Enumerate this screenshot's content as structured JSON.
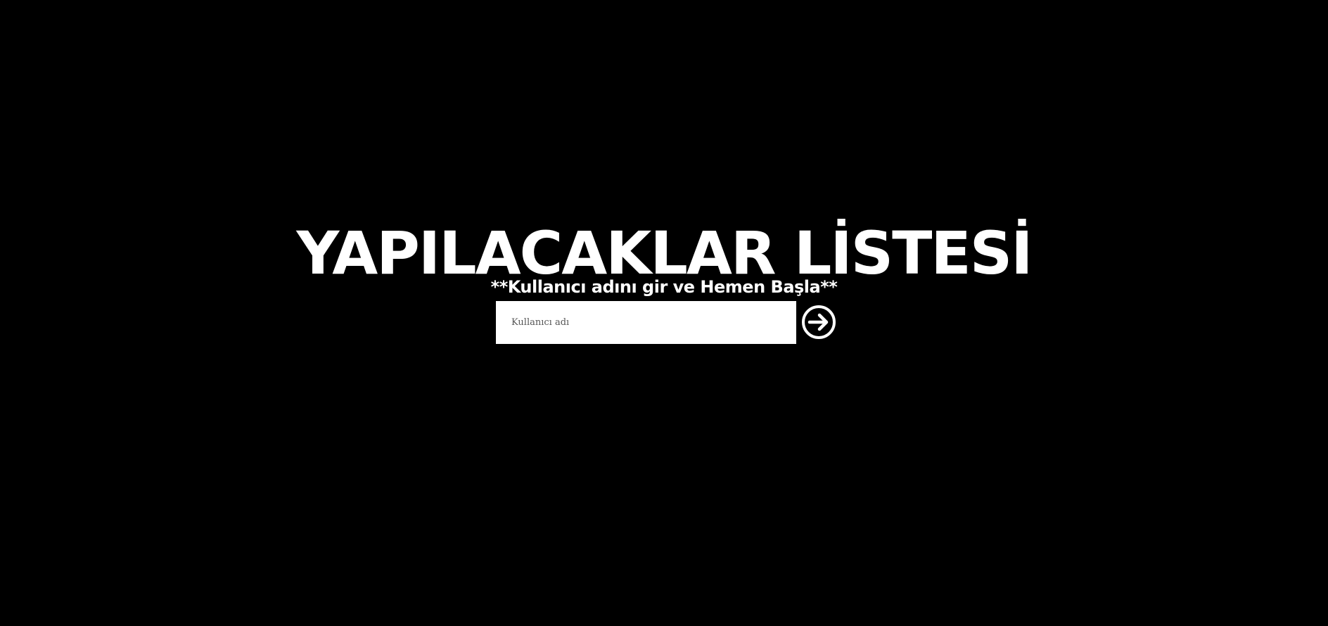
{
  "page": {
    "title": "YAPILACAKLAR LİSTESİ",
    "subtitle": "**Kullanıcı adını gir ve Hemen Başla**"
  },
  "login": {
    "username_placeholder": "Kullanıcı adı",
    "username_value": "",
    "submit_icon": "arrow-right-circle-icon"
  },
  "colors": {
    "background": "#000000",
    "text": "#ffffff",
    "input_background": "#ffffff"
  }
}
